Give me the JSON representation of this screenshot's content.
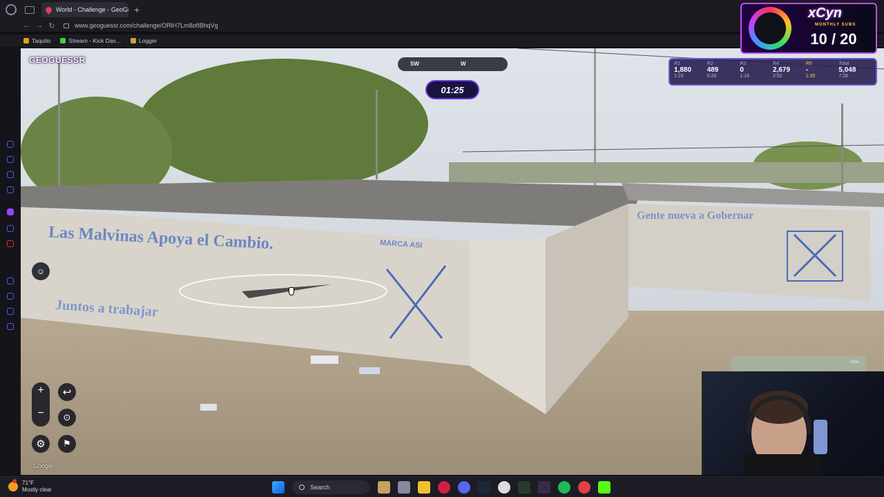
{
  "browser": {
    "tab_title": "World - Challenge - GeoGu",
    "tab_close": "×",
    "new_tab": "+",
    "url": "www.geoguessr.com/challenge/ORlH7Lm8ofIBhqVg",
    "nav_back": "←",
    "nav_forward": "→",
    "nav_reload": "↻",
    "bookmarks": [
      {
        "label": "Taquito",
        "color": "#e0a020"
      },
      {
        "label": "Stream - Kick Das...",
        "color": "#40d040"
      },
      {
        "label": "Logger",
        "color": "#d0a040"
      }
    ]
  },
  "game": {
    "logo": "GEOGUESSR",
    "compass": {
      "left": "SW",
      "right": "W"
    },
    "timer": "01:25",
    "google_attribution": "Google",
    "controls": {
      "zoom_in": "+",
      "zoom_out": "−",
      "undo": "↩",
      "checkpoint": "⊙",
      "settings": "⚙",
      "flag": "⚑",
      "compass_reset": "☺"
    }
  },
  "scene_text": {
    "wall_left_1": "Las Malvinas Apoya el Cambio.",
    "wall_left_2": "Juntos a trabajar",
    "wall_mark": "MARCA ASI",
    "wall_right": "Gente nueva a Gobernar"
  },
  "overlay": {
    "brand": "xCyn",
    "sub_label": "MONTHLY SUBS",
    "sub_count": "10 / 20",
    "rounds": [
      {
        "label": "R1",
        "score": "1,880",
        "time": "1:23",
        "active": false
      },
      {
        "label": "R2",
        "score": "489",
        "time": "0:20",
        "active": false
      },
      {
        "label": "R3",
        "score": "0",
        "time": "1:16",
        "active": false
      },
      {
        "label": "R4",
        "score": "2,679",
        "time": "2:52",
        "active": false
      },
      {
        "label": "R5",
        "score": "-",
        "time": "1:35",
        "active": true
      },
      {
        "label": "Total",
        "score": "5,048",
        "time": "7:26",
        "active": false
      }
    ],
    "minimap_label": "ASIA"
  },
  "taskbar": {
    "temperature": "71°F",
    "weather_text": "Mostly clear",
    "search_label": "Search"
  }
}
